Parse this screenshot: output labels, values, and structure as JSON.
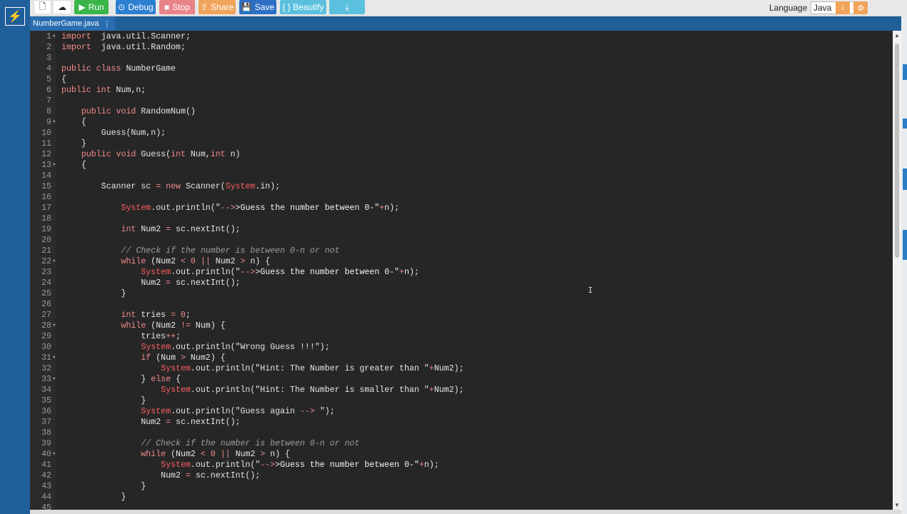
{
  "toolbar": {
    "new_icon": "file-icon",
    "open_icon": "upload-cloud-icon",
    "run": "Run",
    "debug": "Debug",
    "stop": "Stop",
    "share": "Share",
    "save": "Save",
    "beautify": "{ } Beautify",
    "download_icon": "download-icon",
    "language_label": "Language",
    "language_value": "Java",
    "info_icon": "info-icon",
    "settings_icon": "gear-icon"
  },
  "tab": {
    "filename": "NumberGame.java",
    "menu_glyph": "⋮"
  },
  "colors": {
    "sidebar": "#1f5f9a",
    "editor_bg": "#262626",
    "run": "#39b54a",
    "debug": "#2d7fd1",
    "stop": "#e8838a",
    "share": "#f0a35a",
    "save": "#2d6fc5",
    "beautify": "#5bc0de"
  },
  "code_lines": [
    [
      [
        "kw",
        "import"
      ],
      [
        "",
        "  java.util.Scanner;"
      ]
    ],
    [
      [
        "kw",
        "import"
      ],
      [
        "",
        "  java.util.Random;"
      ]
    ],
    [],
    [
      [
        "kw",
        "public class"
      ],
      [
        "",
        " NumberGame"
      ]
    ],
    [
      [
        "",
        "{"
      ]
    ],
    [
      [
        "kw",
        "public int"
      ],
      [
        "",
        " Num,n;"
      ]
    ],
    [],
    [
      [
        "",
        "    "
      ],
      [
        "kw",
        "public void"
      ],
      [
        "",
        " RandomNum()"
      ]
    ],
    [
      [
        "",
        "    {"
      ]
    ],
    [
      [
        "",
        "        Guess(Num,n);"
      ]
    ],
    [
      [
        "",
        "    }"
      ]
    ],
    [
      [
        "",
        "    "
      ],
      [
        "kw",
        "public void"
      ],
      [
        "",
        " Guess("
      ],
      [
        "ty",
        "int"
      ],
      [
        "",
        " Num,"
      ],
      [
        "ty",
        "int"
      ],
      [
        "",
        " n)"
      ]
    ],
    [
      [
        "",
        "    {"
      ]
    ],
    [],
    [
      [
        "",
        "        Scanner sc "
      ],
      [
        "op",
        "="
      ],
      [
        "",
        ""
      ],
      [
        "kw",
        " new"
      ],
      [
        "",
        " Scanner("
      ],
      [
        "sys",
        "System"
      ],
      [
        "",
        ".in);"
      ]
    ],
    [],
    [
      [
        "",
        "            "
      ],
      [
        "sys",
        "System"
      ],
      [
        "",
        ".out.println(\""
      ],
      [
        "op",
        "-->"
      ],
      [
        "st",
        ">Guess the number between 0-\""
      ],
      [
        "op",
        "+"
      ],
      [
        "",
        "n);"
      ]
    ],
    [],
    [
      [
        "",
        "            "
      ],
      [
        "ty",
        "int"
      ],
      [
        "",
        " Num2 "
      ],
      [
        "op",
        "="
      ],
      [
        "",
        " sc.nextInt();"
      ]
    ],
    [],
    [
      [
        "",
        "            "
      ],
      [
        "cm",
        "// Check if the number is between 0-n or not"
      ]
    ],
    [
      [
        "",
        "            "
      ],
      [
        "kw",
        "while"
      ],
      [
        "",
        " (Num2 "
      ],
      [
        "op",
        "<"
      ],
      [
        " ",
        ""
      ],
      [
        "nu",
        " 0"
      ],
      [
        "",
        " "
      ],
      [
        "op",
        "||"
      ],
      [
        "",
        " Num2 "
      ],
      [
        "op",
        ">"
      ],
      [
        "",
        " n) {"
      ]
    ],
    [
      [
        "",
        "                "
      ],
      [
        "sys",
        "System"
      ],
      [
        "",
        ".out.println(\""
      ],
      [
        "op",
        "-->"
      ],
      [
        "st",
        ">Guess the number between 0-\""
      ],
      [
        "op",
        "+"
      ],
      [
        "",
        "n);"
      ]
    ],
    [
      [
        "",
        "                Num2 "
      ],
      [
        "op",
        "="
      ],
      [
        "",
        " sc.nextInt();"
      ]
    ],
    [
      [
        "",
        "            }"
      ]
    ],
    [],
    [
      [
        "",
        "            "
      ],
      [
        "ty",
        "int"
      ],
      [
        "",
        " tries "
      ],
      [
        "op",
        "="
      ],
      [
        "",
        " "
      ],
      [
        "nu",
        "0"
      ],
      [
        "",
        ";"
      ]
    ],
    [
      [
        "",
        "            "
      ],
      [
        "kw",
        "while"
      ],
      [
        "",
        " (Num2 "
      ],
      [
        "op",
        "!="
      ],
      [
        "",
        " Num) {"
      ]
    ],
    [
      [
        "",
        "                tries"
      ],
      [
        "op",
        "++"
      ],
      [
        "",
        ";"
      ]
    ],
    [
      [
        "",
        "                "
      ],
      [
        "sys",
        "System"
      ],
      [
        "",
        ".out.println(\"Wrong Guess !!!\");"
      ]
    ],
    [
      [
        "",
        "                "
      ],
      [
        "kw",
        "if"
      ],
      [
        "",
        " (Num "
      ],
      [
        "op",
        ">"
      ],
      [
        "",
        " Num2) {"
      ]
    ],
    [
      [
        "",
        "                    "
      ],
      [
        "sys",
        "System"
      ],
      [
        "",
        ".out.println(\"Hint: The Number is greater than \""
      ],
      [
        "op",
        "+"
      ],
      [
        "",
        "Num2);"
      ]
    ],
    [
      [
        "",
        "                } "
      ],
      [
        "kw",
        "else"
      ],
      [
        "",
        " {"
      ]
    ],
    [
      [
        "",
        "                    "
      ],
      [
        "sys",
        "System"
      ],
      [
        "",
        ".out.println(\"Hint: The Number is smaller than \""
      ],
      [
        "op",
        "+"
      ],
      [
        "",
        "Num2);"
      ]
    ],
    [
      [
        "",
        "                }"
      ]
    ],
    [
      [
        "",
        "                "
      ],
      [
        "sys",
        "System"
      ],
      [
        "",
        ".out.println(\"Guess again "
      ],
      [
        "op",
        "-->"
      ],
      [
        "",
        " \");"
      ]
    ],
    [
      [
        "",
        "                Num2 "
      ],
      [
        "op",
        "="
      ],
      [
        "",
        " sc.nextInt();"
      ]
    ],
    [],
    [
      [
        "",
        "                "
      ],
      [
        "cm",
        "// Check if the number is between 0-n or not"
      ]
    ],
    [
      [
        "",
        "                "
      ],
      [
        "kw",
        "while"
      ],
      [
        "",
        " (Num2 "
      ],
      [
        "op",
        "<"
      ],
      [
        "",
        " "
      ],
      [
        "nu",
        "0"
      ],
      [
        "",
        " "
      ],
      [
        "op",
        "||"
      ],
      [
        "",
        " Num2 "
      ],
      [
        "op",
        ">"
      ],
      [
        "",
        " n) {"
      ]
    ],
    [
      [
        "",
        "                    "
      ],
      [
        "sys",
        "System"
      ],
      [
        "",
        ".out.println(\""
      ],
      [
        "op",
        "-->"
      ],
      [
        "st",
        ">Guess the number between 0-\""
      ],
      [
        "op",
        "+"
      ],
      [
        "",
        "n);"
      ]
    ],
    [
      [
        "",
        "                    Num2 "
      ],
      [
        "op",
        "="
      ],
      [
        "",
        " sc.nextInt();"
      ]
    ],
    [
      [
        "",
        "                }"
      ]
    ],
    [
      [
        "",
        "            }"
      ]
    ],
    []
  ],
  "line_numbers": [
    "1",
    "2",
    "3",
    "4",
    "5",
    "6",
    "7",
    "8",
    "9",
    "10",
    "11",
    "12",
    "13",
    "14",
    "15",
    "16",
    "17",
    "18",
    "19",
    "20",
    "21",
    "22",
    "23",
    "24",
    "25",
    "26",
    "27",
    "28",
    "29",
    "30",
    "31",
    "32",
    "33",
    "34",
    "35",
    "36",
    "37",
    "38",
    "39",
    "40",
    "41",
    "42",
    "43",
    "44",
    "45"
  ],
  "fold_lines": [
    1,
    9,
    13,
    22,
    28,
    31,
    33,
    40
  ],
  "text_cursor": "I"
}
